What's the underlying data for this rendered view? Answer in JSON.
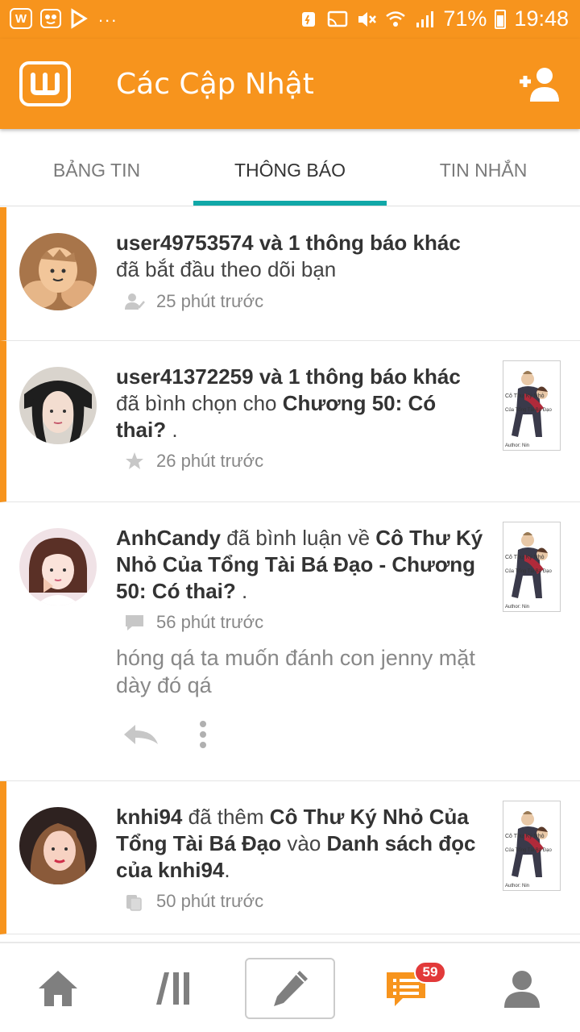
{
  "status_bar": {
    "battery": "71%",
    "time": "19:48",
    "app_icon_letter": "W"
  },
  "app_bar": {
    "title": "Các Cập Nhật"
  },
  "tabs": [
    {
      "label": "BẢNG TIN",
      "active": false
    },
    {
      "label": "THÔNG BÁO",
      "active": true
    },
    {
      "label": "TIN NHẮN",
      "active": false
    }
  ],
  "notifications": [
    {
      "user": "user49753574",
      "extra": "và 1 thông báo khác",
      "action": "đã bắt đầu theo dõi bạn",
      "time": "25 phút trước",
      "icon": "follow-icon",
      "unread": true
    },
    {
      "user": "user41372259",
      "extra": "và 1 thông báo khác",
      "action": "đã bình chọn cho",
      "target": "Chương 50: Có thai?",
      "end": ".",
      "time": "26 phút trước",
      "icon": "star-icon",
      "unread": true
    },
    {
      "user": "AnhCandy",
      "action": "đã bình luận về",
      "target": "Cô Thư Ký Nhỏ Của Tổng Tài Bá Đạo - Chương 50: Có thai?",
      "end": ".",
      "time": "56 phút trước",
      "icon": "comment-icon",
      "comment": "hóng qá ta muốn đánh con jenny mặt dày đó qá",
      "unread": false
    },
    {
      "user": "knhi94",
      "action": "đã thêm",
      "target": "Cô Thư Ký Nhỏ Của Tổng Tài Bá Đạo",
      "mid": "vào",
      "target2": "Danh sách đọc của knhi94",
      "end": ".",
      "time": "50 phút trước",
      "icon": "reading-list-icon",
      "unread": true
    }
  ],
  "thumb": {
    "title_lines": [
      "Cô Thư Ký Nhỏ",
      "Của Tổng Tài Bá Đạo"
    ],
    "author": "Author: Nin"
  },
  "bottom_nav": {
    "badge": "59"
  },
  "colors": {
    "brand": "#f7941d",
    "tab_indicator": "#11a8a8",
    "badge": "#e23a3a"
  }
}
